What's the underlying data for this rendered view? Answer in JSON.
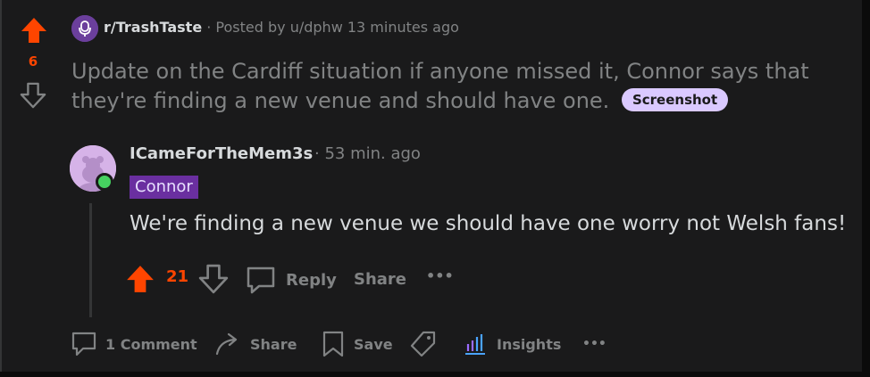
{
  "post": {
    "score": "6",
    "subreddit": "r/TrashTaste",
    "meta_suffix": " · Posted by u/dphw 13 minutes ago",
    "title": "Update on the Cardiff situation if anyone missed it, Connor says that they're finding a new venue and should have one.",
    "flair": "Screenshot"
  },
  "comment": {
    "username": "ICameForTheMem3s",
    "time": "· 53 min. ago",
    "user_flair": "Connor",
    "body": "We're finding a new venue we should have one worry not Welsh fans!",
    "score": "21",
    "reply_label": "Reply",
    "share_label": "Share",
    "more_label": "•••"
  },
  "actions": {
    "comments_label": "1 Comment",
    "share_label": "Share",
    "save_label": "Save",
    "insights_label": "Insights",
    "more_label": "•••"
  },
  "colors": {
    "upvote": "#ff4500",
    "flair_bg": "#dac9ff",
    "user_flair_bg": "#6a2fa0",
    "online": "#46d160"
  },
  "icons": [
    "upvote-icon",
    "downvote-icon",
    "subreddit-icon",
    "avatar",
    "comment-icon",
    "share-icon",
    "save-icon",
    "award-icon",
    "insights-icon",
    "more-icon"
  ]
}
